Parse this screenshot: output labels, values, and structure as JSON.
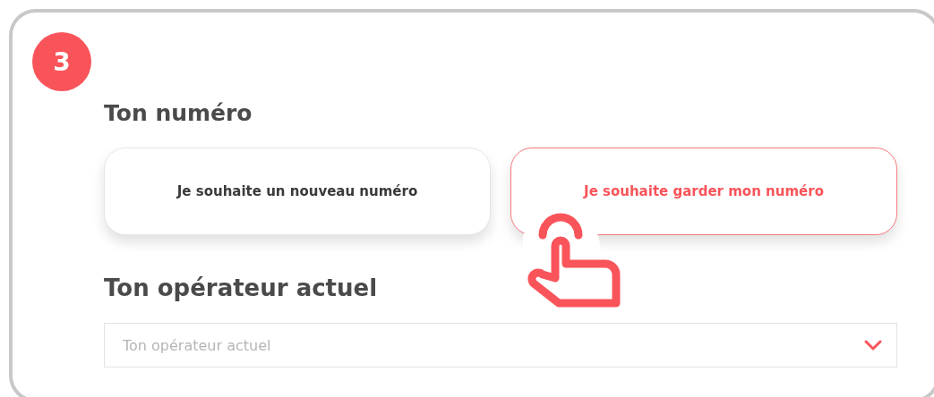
{
  "step": {
    "number": "3"
  },
  "number_section": {
    "heading": "Ton numéro",
    "options": [
      {
        "label": "Je souhaite un nouveau numéro",
        "selected": false
      },
      {
        "label": "Je souhaite garder mon numéro",
        "selected": true
      }
    ]
  },
  "operator_section": {
    "heading": "Ton opérateur actuel",
    "select": {
      "placeholder": "Ton opérateur actuel"
    }
  }
}
